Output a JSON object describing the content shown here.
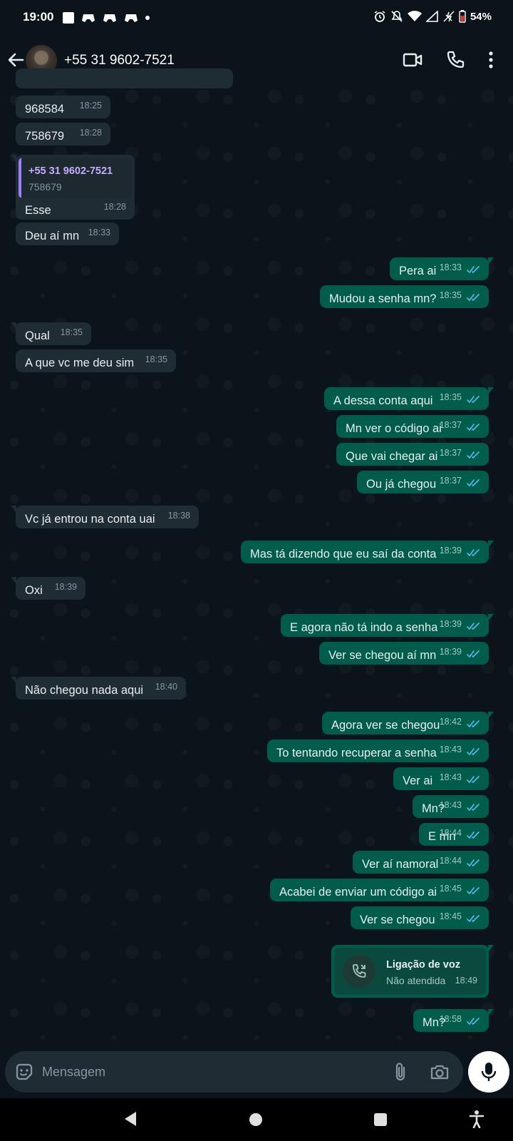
{
  "status_bar": {
    "time": "19:00",
    "battery": "54%"
  },
  "header": {
    "contact_name": "+55 31 9602-7521"
  },
  "messages": [
    {
      "dir": "in",
      "text": "968584",
      "time": "18:25"
    },
    {
      "dir": "in",
      "text": "758679",
      "time": "18:28"
    },
    {
      "dir": "in",
      "quote_name": "+55 31 9602-7521",
      "quote_text": "758679",
      "text": "Esse",
      "time": "18:28"
    },
    {
      "dir": "in",
      "text": "Deu aí mn",
      "time": "18:33"
    },
    {
      "dir": "out",
      "text": "Pera ai",
      "time": "18:33"
    },
    {
      "dir": "out",
      "text": "Mudou a senha mn?",
      "time": "18:35"
    },
    {
      "dir": "in",
      "text": "Qual",
      "time": "18:35"
    },
    {
      "dir": "in",
      "text": "A que vc me deu sim",
      "time": "18:35"
    },
    {
      "dir": "out",
      "text": "A dessa conta aqui",
      "time": "18:35"
    },
    {
      "dir": "out",
      "text": "Mn ver o código ai",
      "time": "18:37"
    },
    {
      "dir": "out",
      "text": "Que vai chegar ai",
      "time": "18:37"
    },
    {
      "dir": "out",
      "text": "Ou já chegou",
      "time": "18:37"
    },
    {
      "dir": "in",
      "text": "Vc já entrou na conta uai",
      "time": "18:38"
    },
    {
      "dir": "out",
      "text": "Mas tá dizendo que eu saí da conta",
      "time": "18:39"
    },
    {
      "dir": "in",
      "text": "Oxi",
      "time": "18:39"
    },
    {
      "dir": "out",
      "text": "E agora não tá indo a senha",
      "time": "18:39"
    },
    {
      "dir": "out",
      "text": "Ver se chegou aí mn",
      "time": "18:39"
    },
    {
      "dir": "in",
      "text": "Não chegou nada aqui",
      "time": "18:40"
    },
    {
      "dir": "out",
      "text": "Agora ver se chegou",
      "time": "18:42"
    },
    {
      "dir": "out",
      "text": "To tentando recuperar a senha",
      "time": "18:43"
    },
    {
      "dir": "out",
      "text": "Ver ai",
      "time": "18:43"
    },
    {
      "dir": "out",
      "text": "Mn?",
      "time": "18:43"
    },
    {
      "dir": "out",
      "text": "E mn",
      "time": "18:44"
    },
    {
      "dir": "out",
      "text": "Ver aí namoral",
      "time": "18:44"
    },
    {
      "dir": "out",
      "text": "Acabei de enviar um código ai",
      "time": "18:45"
    },
    {
      "dir": "out",
      "text": "Ver se chegou",
      "time": "18:45"
    },
    {
      "dir": "out",
      "call_title": "Ligação de voz",
      "call_status": "Não atendida",
      "time": "18:49"
    },
    {
      "dir": "out",
      "text": "Mn?",
      "time": "18:58"
    }
  ],
  "composer": {
    "placeholder": "Mensagem"
  },
  "icons": {
    "back": "arrow-left-icon",
    "video": "video-camera-icon",
    "call": "phone-icon",
    "more": "more-vertical-icon",
    "emoji": "sticker-icon",
    "attach": "paperclip-icon",
    "camera": "camera-icon",
    "mic": "microphone-icon",
    "read": "double-check-icon"
  },
  "colors": {
    "background": "#0b141a",
    "incoming": "#202c33",
    "outgoing": "#005c4b",
    "read_check": "#53bdeb"
  }
}
